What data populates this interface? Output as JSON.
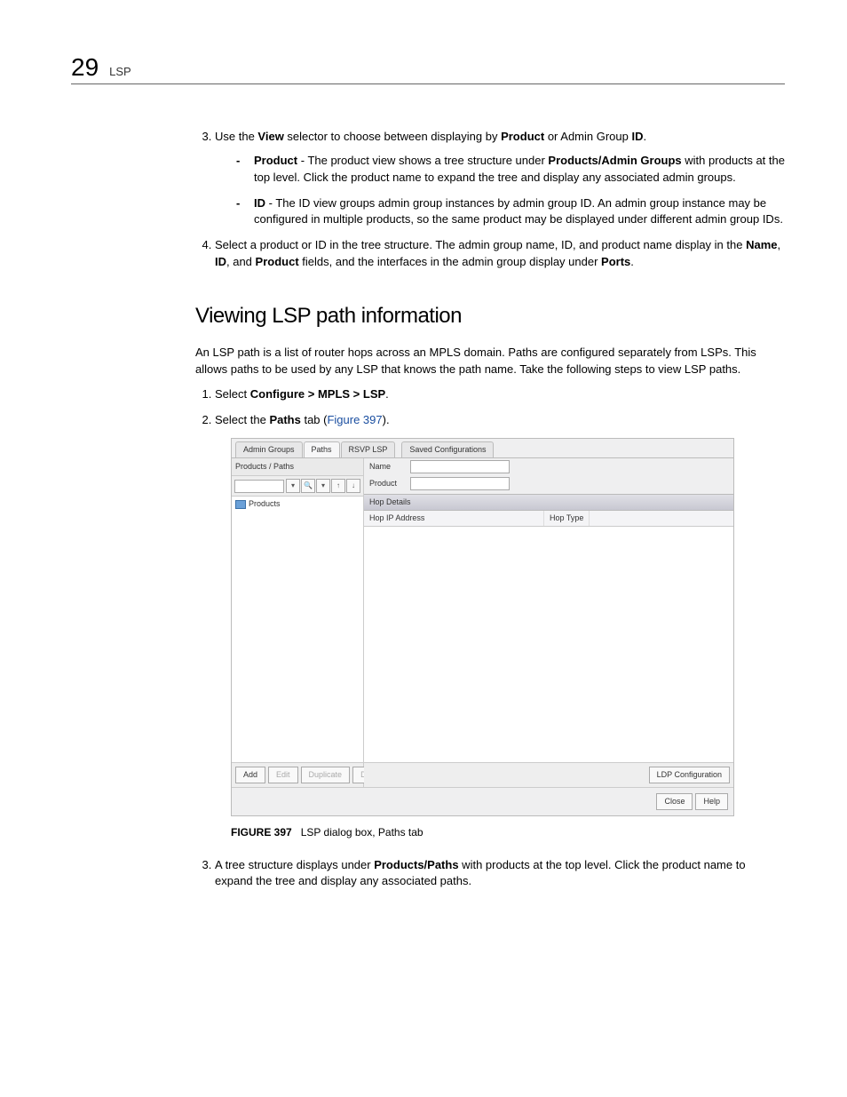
{
  "header": {
    "chapter_number": "29",
    "running_head": "LSP"
  },
  "list1": {
    "start": 3,
    "item3": {
      "pre": "Use the ",
      "b1": "View",
      "mid1": " selector to choose between displaying by ",
      "b2": "Product",
      "mid2": " or Admin Group ",
      "b3": "ID",
      "post": ".",
      "dash1": {
        "b": "Product",
        "t1": " - The product view shows a tree structure under ",
        "b2": "Products/Admin Groups",
        "t2": " with products at the top level. Click the product name to expand the tree and display any associated admin groups."
      },
      "dash2": {
        "b": "ID",
        "t": " - The ID view groups admin group instances by admin group ID. An admin group instance may be configured in multiple products, so the same product may be displayed under different admin group IDs."
      }
    },
    "item4": {
      "t1": "Select a product or ID in the tree structure. The admin group name, ID, and product name display in the ",
      "b1": "Name",
      "t2": ", ",
      "b2": "ID",
      "t3": ", and ",
      "b3": "Product",
      "t4": " fields, and the interfaces in the admin group display under ",
      "b4": "Ports",
      "t5": "."
    }
  },
  "section_heading": "Viewing LSP path information",
  "intro_para": "An LSP path is a list of router hops across an MPLS domain. Paths are configured separately from LSPs. This allows paths to be used by any LSP that knows the path name. Take the following steps to view LSP paths.",
  "list2": {
    "item1": {
      "t1": "Select ",
      "b1": "Configure > MPLS > LSP",
      "t2": "."
    },
    "item2": {
      "t1": "Select the ",
      "b1": "Paths",
      "t2": " tab (",
      "link": "Figure 397",
      "t3": ")."
    },
    "item3": {
      "t1": "A tree structure displays under ",
      "b1": "Products/Paths",
      "t2": " with products at the top level. Click the product name to expand the tree and display any associated paths."
    }
  },
  "figure": {
    "tabs": {
      "t1": "Admin Groups",
      "t2": "Paths",
      "t3": "RSVP LSP",
      "t4": "Saved Configurations"
    },
    "left": {
      "title": "Products / Paths",
      "tree_root": "Products",
      "buttons": {
        "add": "Add",
        "edit": "Edit",
        "dup": "Duplicate",
        "del": "Delete"
      }
    },
    "right": {
      "name_label": "Name",
      "product_label": "Product",
      "hop_header": "Hop Details",
      "col1": "Hop IP Address",
      "col2": "Hop Type",
      "ldp_btn": "LDP Configuration"
    },
    "footer": {
      "close": "Close",
      "help": "Help"
    },
    "caption_num": "FIGURE 397",
    "caption_text": "LSP dialog box, Paths tab"
  }
}
